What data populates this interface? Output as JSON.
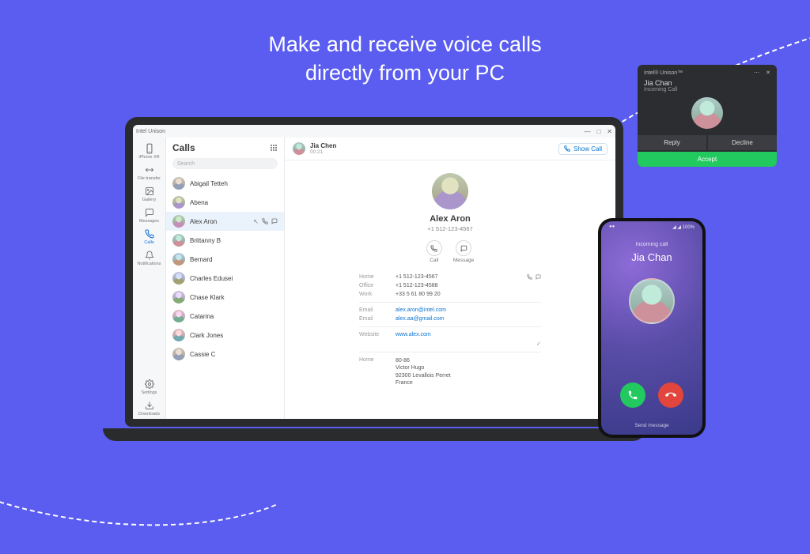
{
  "headline_line1": "Make and receive voice calls",
  "headline_line2": "directly from your PC",
  "app": {
    "title": "Intel Unison",
    "win": {
      "min": "—",
      "max": "□",
      "close": "✕"
    },
    "rail": {
      "items": [
        {
          "label": "iPhone XR",
          "icon": "phone-device"
        },
        {
          "label": "File transfer",
          "icon": "swap"
        },
        {
          "label": "Gallery",
          "icon": "image"
        },
        {
          "label": "Messages",
          "icon": "chat"
        },
        {
          "label": "Calls",
          "icon": "phone"
        },
        {
          "label": "Notifications",
          "icon": "bell"
        }
      ],
      "bottom": [
        {
          "label": "Settings",
          "icon": "gear"
        },
        {
          "label": "Downloads",
          "icon": "download"
        }
      ]
    },
    "list": {
      "title": "Calls",
      "search_placeholder": "Search",
      "contacts": [
        "Abigail Tetteh",
        "Abena",
        "Alex Aron",
        "Brittanny B",
        "Bernard",
        "Charles Edusei",
        "Chase Klark",
        "Catarina",
        "Clark Jones",
        "Cassie C"
      ],
      "selected_index": 2
    },
    "call_header": {
      "name": "Jia Chen",
      "time": "00:21",
      "show_call": "Show Call"
    },
    "contact": {
      "name": "Alex Aron",
      "primary_phone": "+1 512-123-4567",
      "actions": {
        "call": "Call",
        "message": "Message"
      },
      "rows": [
        {
          "k": "Home",
          "v": "+1 512-123-4567",
          "icons": true
        },
        {
          "k": "Office",
          "v": "+1 512-123-4588",
          "icons": false
        },
        {
          "k": "Work",
          "v": "+33 5 61 80 99 20",
          "icons": false
        }
      ],
      "emails": [
        {
          "k": "Email",
          "v": "alex.aron@intel.com"
        },
        {
          "k": "Email",
          "v": "alex.aa@gmail.com"
        }
      ],
      "website": {
        "k": "Website",
        "v": "www.alex.com"
      },
      "address": {
        "k": "Home",
        "lines": [
          "80-86",
          "Victor Hugo",
          "92300 Levallois Perret",
          "France"
        ]
      }
    }
  },
  "phone": {
    "label": "Incoming call",
    "name": "Jia Chan",
    "send_message": "Send message"
  },
  "toast": {
    "app": "Intel® Unison™",
    "name": "Jia Chan",
    "sub": "Incoming Call",
    "reply": "Reply",
    "decline": "Decline",
    "accept": "Accept"
  }
}
